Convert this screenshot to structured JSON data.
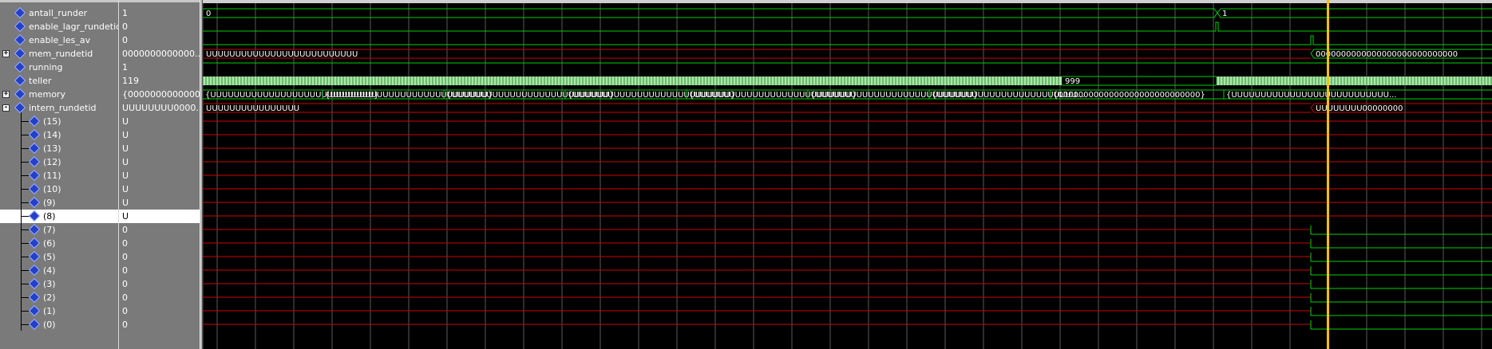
{
  "signals": [
    {
      "name": "antall_runder",
      "value": "1",
      "kind": "leaf"
    },
    {
      "name": "enable_lagr_rundetid",
      "value": "0",
      "kind": "leaf"
    },
    {
      "name": "enable_les_av",
      "value": "0",
      "kind": "leaf"
    },
    {
      "name": "mem_rundetid",
      "value": "0000000000000...",
      "kind": "collapsed"
    },
    {
      "name": "running",
      "value": "1",
      "kind": "leaf"
    },
    {
      "name": "teller",
      "value": "119",
      "kind": "leaf"
    },
    {
      "name": "memory",
      "value": "{0000000000000...",
      "kind": "collapsed"
    },
    {
      "name": "intern_rundetid",
      "value": "UUUUUUUU0000...",
      "kind": "expanded"
    },
    {
      "name": "(15)",
      "value": "U",
      "kind": "child"
    },
    {
      "name": "(14)",
      "value": "U",
      "kind": "child"
    },
    {
      "name": "(13)",
      "value": "U",
      "kind": "child"
    },
    {
      "name": "(12)",
      "value": "U",
      "kind": "child"
    },
    {
      "name": "(11)",
      "value": "U",
      "kind": "child"
    },
    {
      "name": "(10)",
      "value": "U",
      "kind": "child"
    },
    {
      "name": "(9)",
      "value": "U",
      "kind": "child"
    },
    {
      "name": "(8)",
      "value": "U",
      "kind": "child",
      "selected": true
    },
    {
      "name": "(7)",
      "value": "0",
      "kind": "child"
    },
    {
      "name": "(6)",
      "value": "0",
      "kind": "child"
    },
    {
      "name": "(5)",
      "value": "0",
      "kind": "child"
    },
    {
      "name": "(4)",
      "value": "0",
      "kind": "child"
    },
    {
      "name": "(3)",
      "value": "0",
      "kind": "child"
    },
    {
      "name": "(2)",
      "value": "0",
      "kind": "child"
    },
    {
      "name": "(1)",
      "value": "0",
      "kind": "child"
    },
    {
      "name": "(0)",
      "value": "0",
      "kind": "child"
    }
  ],
  "wave_labels": {
    "antall_runder_start": "0",
    "antall_runder_next": "1",
    "mem_rundetid_start": "UUUUUUUUUUUUUUUUUUUUUUUUUU",
    "mem_rundetid_end": "0000000000000000000000000000",
    "teller_label": "999",
    "memory_segments": [
      "{UUUUUUUUUUUUUUUUUUUUUUUUUUUU}",
      "{UUUUUUUUUUUUUUUUUUUUUUUUUUU}",
      "{UUUUUUUUUUUUUUUUUUUUUUUUUUU}",
      "{UUUUUUUUUUUUUUUUUUUUUUUUUUU}",
      "{UUUUUUUUUUUUUUUUUUUUUUUUUUU}",
      "{UUUUUUUUUUUUUUUUUUUUUUUUUUU}",
      "{UUUUUUUUUUUUUUUUUUUUUUUU...",
      "{0000000000000000000000000000}",
      "{UUUUUUUUUUUUUUUUUUUUUUUUUUU..."
    ],
    "intern_rundetid_start": "UUUUUUUUUUUUUUUU",
    "intern_rundetid_end": "UUUUUUUU00000000"
  },
  "colors": {
    "pane_bg": "#7a7a7a",
    "wave_bg": "#000000",
    "green": "#00d000",
    "red": "#d00000",
    "grid": "#5a5a5a",
    "cursor": "#f2c300",
    "diamond": "#2540c8"
  },
  "icons": {
    "signal": "diamond-signal-icon",
    "expand": "plus-expander-icon",
    "collapse": "minus-expander-icon"
  }
}
